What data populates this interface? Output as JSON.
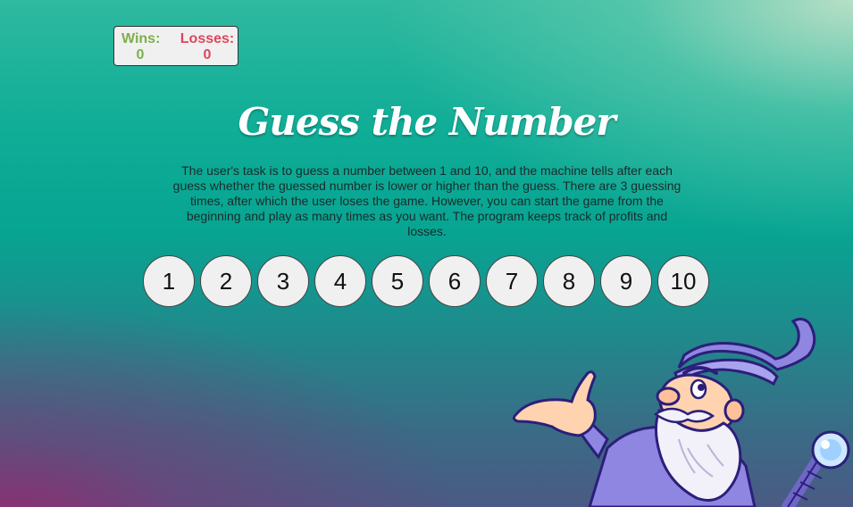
{
  "scoreboard": {
    "wins_label": "Wins:",
    "wins_value": "0",
    "losses_label": "Losses:",
    "losses_value": "0"
  },
  "title": "Guess the Number",
  "description": "The user's task is to guess a number between 1 and 10, and the machine tells after each guess whether the guessed number is lower or higher than the guess. There are 3 guessing times, after which the user loses the game. However, you can start the game from the beginning and play as many times as you want. The program keeps track of profits and losses.",
  "numbers": [
    "1",
    "2",
    "3",
    "4",
    "5",
    "6",
    "7",
    "8",
    "9",
    "10"
  ],
  "colors": {
    "wins": "#7bb04a",
    "losses": "#e0455a",
    "button_bg": "#f0f0f0",
    "wizard_robe": "#8e86e0"
  },
  "illustration": "wizard-mascot"
}
